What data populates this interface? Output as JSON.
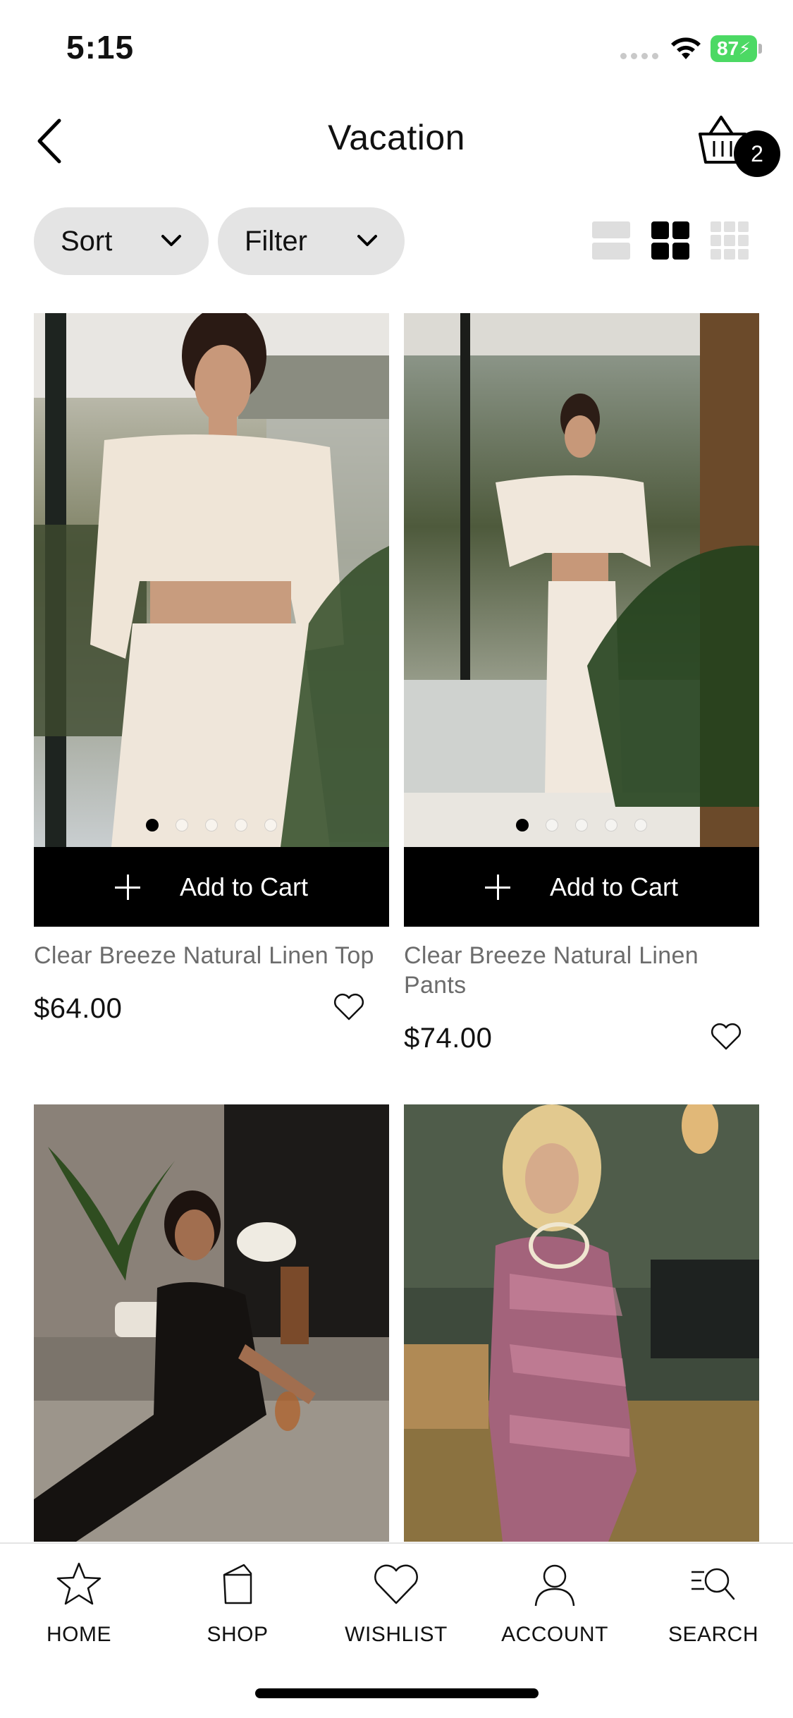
{
  "status": {
    "time": "5:15",
    "battery": "87"
  },
  "header": {
    "title": "Vacation",
    "cart_count": "2"
  },
  "controls": {
    "sort_label": "Sort",
    "filter_label": "Filter"
  },
  "products": [
    {
      "name": "Clear Breeze Natural Linen Top",
      "price": "$64.00",
      "cta": "Add to Cart",
      "dots": 5,
      "active_dot": 1
    },
    {
      "name": "Clear Breeze Natural Linen Pants",
      "price": "$74.00",
      "cta": "Add to Cart",
      "dots": 5,
      "active_dot": 1
    },
    {
      "name": "",
      "price": ""
    },
    {
      "name": "",
      "price": ""
    }
  ],
  "nav": [
    {
      "label": "HOME",
      "icon": "star-icon"
    },
    {
      "label": "SHOP",
      "icon": "shopping-bag-icon"
    },
    {
      "label": "WISHLIST",
      "icon": "heart-icon"
    },
    {
      "label": "ACCOUNT",
      "icon": "user-icon"
    },
    {
      "label": "SEARCH",
      "icon": "search-icon"
    }
  ],
  "colors": {
    "accent": "#000000",
    "pill": "#e4e4e4",
    "muted_text": "#6c6c6c",
    "battery": "#4cd964"
  }
}
